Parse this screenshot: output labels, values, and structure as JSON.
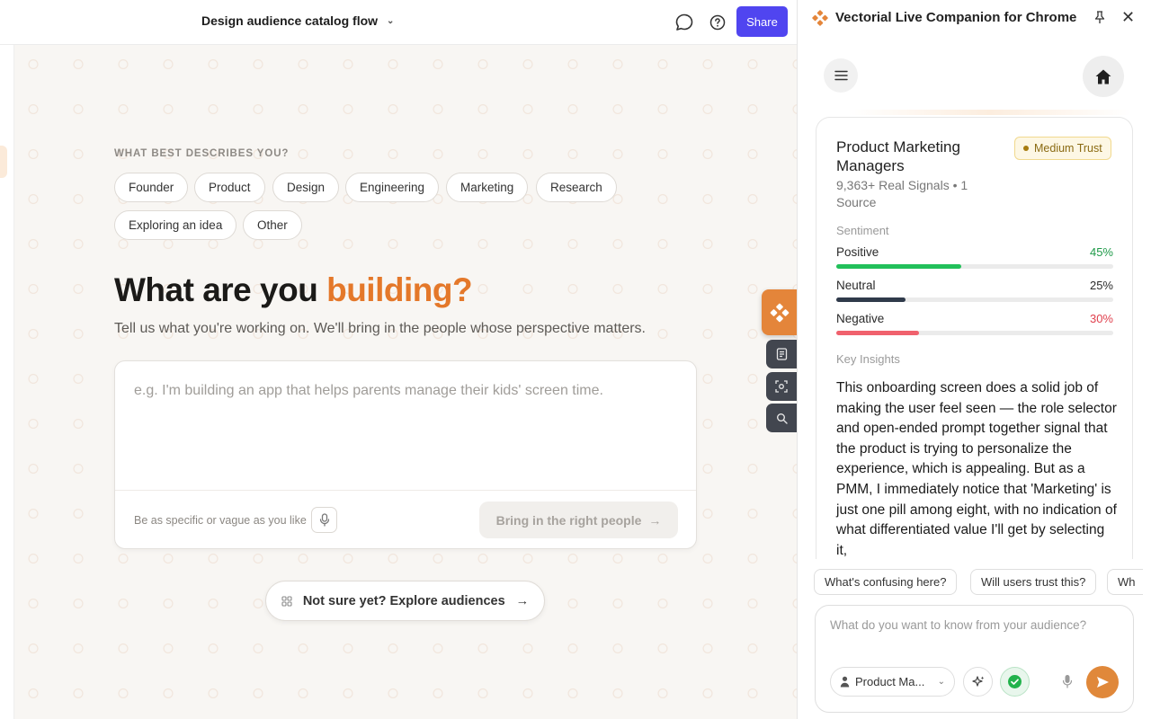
{
  "header": {
    "doc_title": "Design audience catalog flow",
    "share_label": "Share",
    "icons": [
      "comment-icon",
      "help-icon",
      "chevron-down-icon"
    ]
  },
  "main": {
    "section_label": "WHAT BEST DESCRIBES YOU?",
    "roles": [
      "Founder",
      "Product",
      "Design",
      "Engineering",
      "Marketing",
      "Research",
      "Exploring an idea",
      "Other"
    ],
    "headline_main": "What are you ",
    "headline_accent": "building?",
    "accent_color": "#e4782a",
    "subtitle": "Tell us what you're working on. We'll bring in the people whose perspective matters.",
    "input_placeholder": "e.g. I'm building an app that helps parents manage their kids' screen time.",
    "hint": "Be as specific or vague as you like",
    "bring_button": "Bring in the right people",
    "explore_button": "Not sure yet? Explore audiences"
  },
  "panel": {
    "title": "Vectorial Live Companion for Chrome",
    "brand_color": "#e4853a",
    "audience": {
      "name": "Product Marketing Managers",
      "trust": "Medium Trust",
      "signals": "9,363+ Real Signals • 1 Source"
    },
    "sentiment_label": "Sentiment",
    "sentiment": [
      {
        "label": "Positive",
        "value": "45%",
        "fraction": 0.45,
        "color": "#22c05a",
        "text_color": "#1f9a49"
      },
      {
        "label": "Neutral",
        "value": "25%",
        "fraction": 0.25,
        "color": "#2f3a4a",
        "text_color": "#2a2a2a"
      },
      {
        "label": "Negative",
        "value": "30%",
        "fraction": 0.3,
        "color": "#f0616d",
        "text_color": "#e0414e"
      }
    ],
    "insights_label": "Key Insights",
    "insight_text": "This onboarding screen does a solid job of making the user feel seen — the role selector and open-ended prompt together signal that the product is trying to personalize the experience, which is appealing. But as a PMM, I immediately notice that 'Marketing' is just one pill among eight, with no indication of what differentiated value I'll get by selecting it,",
    "chips": [
      "What's confusing here?",
      "Will users trust this?",
      "Wh"
    ],
    "ask_placeholder": "What do you want to know from your audience?",
    "audience_select": "Product Ma..."
  }
}
